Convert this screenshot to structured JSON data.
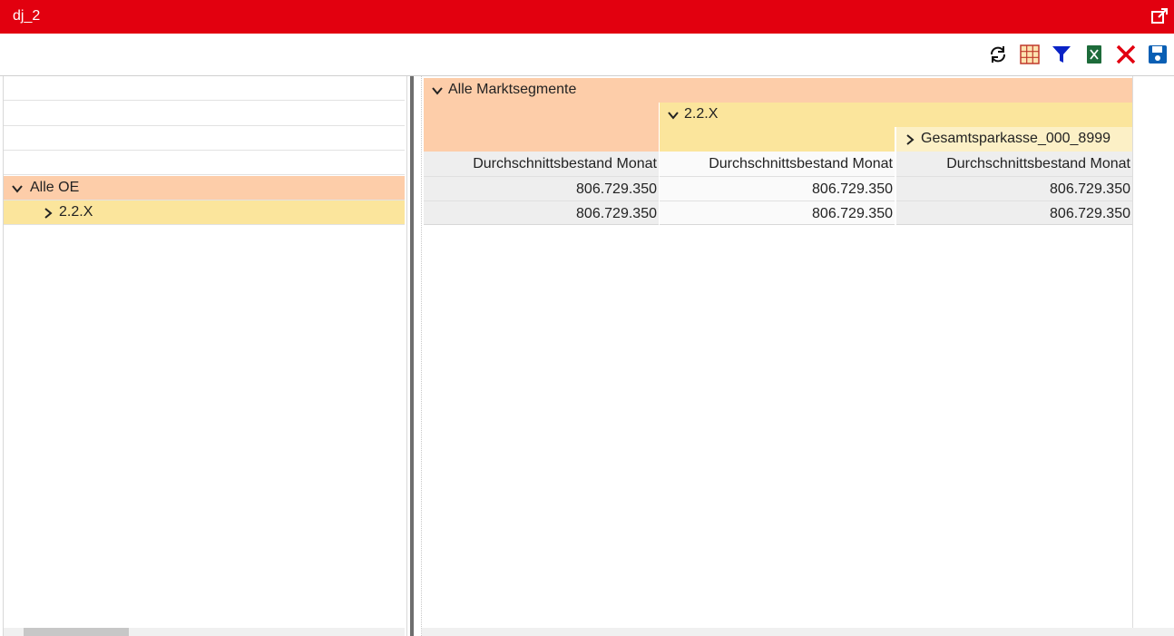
{
  "window": {
    "title": "dj_2",
    "external_icon": "external-link-icon"
  },
  "toolbar": {
    "icons": [
      "refresh-icon",
      "table-grid-icon",
      "filter-icon",
      "excel-export-icon",
      "close-icon",
      "save-icon"
    ]
  },
  "rows_tree": {
    "root_label": "Alle OE",
    "child_label": "2.2.X"
  },
  "columns_tree": {
    "root_label": "Alle Marktsegmente",
    "level2_label": "2.2.X",
    "level3_label": "Gesamtsparkasse_000_8999"
  },
  "measure_headers": [
    "Durchschnittsbestand Monat",
    "Durchschnittsbestand Monat",
    "Durchschnittsbestand Monat"
  ],
  "data_rows": [
    [
      "806.729.350",
      "806.729.350",
      "806.729.350"
    ],
    [
      "806.729.350",
      "806.729.350",
      "806.729.350"
    ]
  ],
  "colors": {
    "title_bar": "#e2000f",
    "level1": "#fdcda9",
    "level2": "#fbe59c",
    "level3": "#fcf0c6"
  }
}
